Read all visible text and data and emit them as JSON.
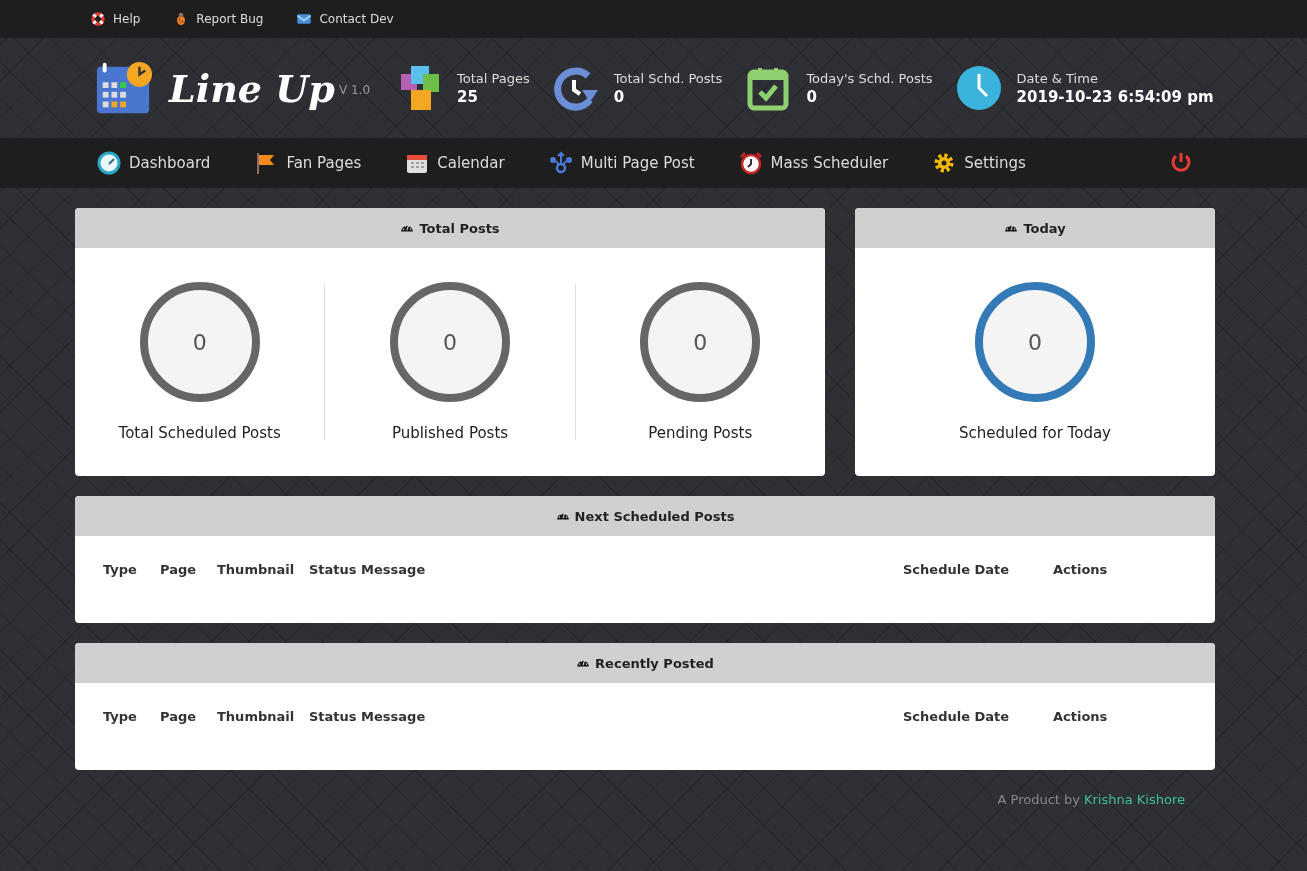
{
  "top_links": [
    {
      "label": "Help",
      "kind": "help"
    },
    {
      "label": "Report Bug",
      "kind": "bug"
    },
    {
      "label": "Contact Dev",
      "kind": "mail"
    }
  ],
  "brand": {
    "name": "Line Up",
    "version": "V 1.0"
  },
  "stats": [
    {
      "label": "Total Pages",
      "value": "25",
      "kind": "pages"
    },
    {
      "label": "Total Schd. Posts",
      "value": "0",
      "kind": "history"
    },
    {
      "label": "Today's Schd. Posts",
      "value": "0",
      "kind": "calendar-check"
    },
    {
      "label": "Date & Time",
      "value": "2019-10-23 6:54:09 pm",
      "kind": "clock"
    }
  ],
  "nav": [
    {
      "label": "Dashboard",
      "kind": "dashboard"
    },
    {
      "label": "Fan Pages",
      "kind": "flag"
    },
    {
      "label": "Calendar",
      "kind": "calendar"
    },
    {
      "label": "Multi Page Post",
      "kind": "share"
    },
    {
      "label": "Mass Scheduler",
      "kind": "alarm"
    },
    {
      "label": "Settings",
      "kind": "gear"
    }
  ],
  "summary_panels": [
    {
      "title": "Total Posts",
      "gauges": [
        {
          "value": "0",
          "label": "Total Scheduled Posts",
          "color": "#666666"
        },
        {
          "value": "0",
          "label": "Published Posts",
          "color": "#666666"
        },
        {
          "value": "0",
          "label": "Pending Posts",
          "color": "#666666"
        }
      ]
    },
    {
      "title": "Today",
      "gauges": [
        {
          "value": "0",
          "label": "Scheduled for Today",
          "color": "#337ab7"
        }
      ]
    }
  ],
  "tables": [
    {
      "title": "Next Scheduled Posts",
      "columns": [
        "Type",
        "Page",
        "Thumbnail",
        "Status Message",
        "Schedule Date",
        "Actions"
      ]
    },
    {
      "title": "Recently Posted",
      "columns": [
        "Type",
        "Page",
        "Thumbnail",
        "Status Message",
        "Schedule Date",
        "Actions"
      ]
    }
  ],
  "footer": {
    "text": "A Product by",
    "link": "Krishna Kishore"
  }
}
